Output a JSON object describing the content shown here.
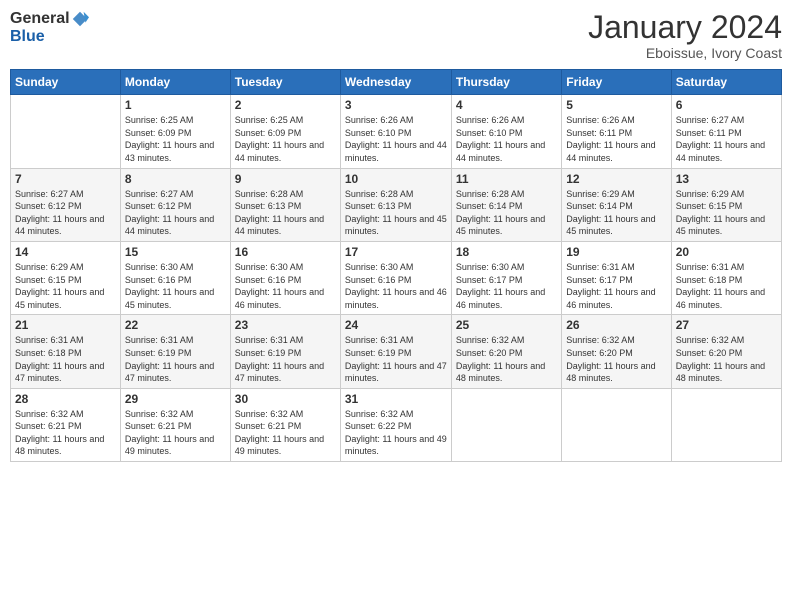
{
  "logo": {
    "general": "General",
    "blue": "Blue"
  },
  "title": "January 2024",
  "location": "Eboissue, Ivory Coast",
  "headers": [
    "Sunday",
    "Monday",
    "Tuesday",
    "Wednesday",
    "Thursday",
    "Friday",
    "Saturday"
  ],
  "weeks": [
    [
      {
        "day": "",
        "sunrise": "",
        "sunset": "",
        "daylight": ""
      },
      {
        "day": "1",
        "sunrise": "Sunrise: 6:25 AM",
        "sunset": "Sunset: 6:09 PM",
        "daylight": "Daylight: 11 hours and 43 minutes."
      },
      {
        "day": "2",
        "sunrise": "Sunrise: 6:25 AM",
        "sunset": "Sunset: 6:09 PM",
        "daylight": "Daylight: 11 hours and 44 minutes."
      },
      {
        "day": "3",
        "sunrise": "Sunrise: 6:26 AM",
        "sunset": "Sunset: 6:10 PM",
        "daylight": "Daylight: 11 hours and 44 minutes."
      },
      {
        "day": "4",
        "sunrise": "Sunrise: 6:26 AM",
        "sunset": "Sunset: 6:10 PM",
        "daylight": "Daylight: 11 hours and 44 minutes."
      },
      {
        "day": "5",
        "sunrise": "Sunrise: 6:26 AM",
        "sunset": "Sunset: 6:11 PM",
        "daylight": "Daylight: 11 hours and 44 minutes."
      },
      {
        "day": "6",
        "sunrise": "Sunrise: 6:27 AM",
        "sunset": "Sunset: 6:11 PM",
        "daylight": "Daylight: 11 hours and 44 minutes."
      }
    ],
    [
      {
        "day": "7",
        "sunrise": "Sunrise: 6:27 AM",
        "sunset": "Sunset: 6:12 PM",
        "daylight": "Daylight: 11 hours and 44 minutes."
      },
      {
        "day": "8",
        "sunrise": "Sunrise: 6:27 AM",
        "sunset": "Sunset: 6:12 PM",
        "daylight": "Daylight: 11 hours and 44 minutes."
      },
      {
        "day": "9",
        "sunrise": "Sunrise: 6:28 AM",
        "sunset": "Sunset: 6:13 PM",
        "daylight": "Daylight: 11 hours and 44 minutes."
      },
      {
        "day": "10",
        "sunrise": "Sunrise: 6:28 AM",
        "sunset": "Sunset: 6:13 PM",
        "daylight": "Daylight: 11 hours and 45 minutes."
      },
      {
        "day": "11",
        "sunrise": "Sunrise: 6:28 AM",
        "sunset": "Sunset: 6:14 PM",
        "daylight": "Daylight: 11 hours and 45 minutes."
      },
      {
        "day": "12",
        "sunrise": "Sunrise: 6:29 AM",
        "sunset": "Sunset: 6:14 PM",
        "daylight": "Daylight: 11 hours and 45 minutes."
      },
      {
        "day": "13",
        "sunrise": "Sunrise: 6:29 AM",
        "sunset": "Sunset: 6:15 PM",
        "daylight": "Daylight: 11 hours and 45 minutes."
      }
    ],
    [
      {
        "day": "14",
        "sunrise": "Sunrise: 6:29 AM",
        "sunset": "Sunset: 6:15 PM",
        "daylight": "Daylight: 11 hours and 45 minutes."
      },
      {
        "day": "15",
        "sunrise": "Sunrise: 6:30 AM",
        "sunset": "Sunset: 6:16 PM",
        "daylight": "Daylight: 11 hours and 45 minutes."
      },
      {
        "day": "16",
        "sunrise": "Sunrise: 6:30 AM",
        "sunset": "Sunset: 6:16 PM",
        "daylight": "Daylight: 11 hours and 46 minutes."
      },
      {
        "day": "17",
        "sunrise": "Sunrise: 6:30 AM",
        "sunset": "Sunset: 6:16 PM",
        "daylight": "Daylight: 11 hours and 46 minutes."
      },
      {
        "day": "18",
        "sunrise": "Sunrise: 6:30 AM",
        "sunset": "Sunset: 6:17 PM",
        "daylight": "Daylight: 11 hours and 46 minutes."
      },
      {
        "day": "19",
        "sunrise": "Sunrise: 6:31 AM",
        "sunset": "Sunset: 6:17 PM",
        "daylight": "Daylight: 11 hours and 46 minutes."
      },
      {
        "day": "20",
        "sunrise": "Sunrise: 6:31 AM",
        "sunset": "Sunset: 6:18 PM",
        "daylight": "Daylight: 11 hours and 46 minutes."
      }
    ],
    [
      {
        "day": "21",
        "sunrise": "Sunrise: 6:31 AM",
        "sunset": "Sunset: 6:18 PM",
        "daylight": "Daylight: 11 hours and 47 minutes."
      },
      {
        "day": "22",
        "sunrise": "Sunrise: 6:31 AM",
        "sunset": "Sunset: 6:19 PM",
        "daylight": "Daylight: 11 hours and 47 minutes."
      },
      {
        "day": "23",
        "sunrise": "Sunrise: 6:31 AM",
        "sunset": "Sunset: 6:19 PM",
        "daylight": "Daylight: 11 hours and 47 minutes."
      },
      {
        "day": "24",
        "sunrise": "Sunrise: 6:31 AM",
        "sunset": "Sunset: 6:19 PM",
        "daylight": "Daylight: 11 hours and 47 minutes."
      },
      {
        "day": "25",
        "sunrise": "Sunrise: 6:32 AM",
        "sunset": "Sunset: 6:20 PM",
        "daylight": "Daylight: 11 hours and 48 minutes."
      },
      {
        "day": "26",
        "sunrise": "Sunrise: 6:32 AM",
        "sunset": "Sunset: 6:20 PM",
        "daylight": "Daylight: 11 hours and 48 minutes."
      },
      {
        "day": "27",
        "sunrise": "Sunrise: 6:32 AM",
        "sunset": "Sunset: 6:20 PM",
        "daylight": "Daylight: 11 hours and 48 minutes."
      }
    ],
    [
      {
        "day": "28",
        "sunrise": "Sunrise: 6:32 AM",
        "sunset": "Sunset: 6:21 PM",
        "daylight": "Daylight: 11 hours and 48 minutes."
      },
      {
        "day": "29",
        "sunrise": "Sunrise: 6:32 AM",
        "sunset": "Sunset: 6:21 PM",
        "daylight": "Daylight: 11 hours and 49 minutes."
      },
      {
        "day": "30",
        "sunrise": "Sunrise: 6:32 AM",
        "sunset": "Sunset: 6:21 PM",
        "daylight": "Daylight: 11 hours and 49 minutes."
      },
      {
        "day": "31",
        "sunrise": "Sunrise: 6:32 AM",
        "sunset": "Sunset: 6:22 PM",
        "daylight": "Daylight: 11 hours and 49 minutes."
      },
      {
        "day": "",
        "sunrise": "",
        "sunset": "",
        "daylight": ""
      },
      {
        "day": "",
        "sunrise": "",
        "sunset": "",
        "daylight": ""
      },
      {
        "day": "",
        "sunrise": "",
        "sunset": "",
        "daylight": ""
      }
    ]
  ]
}
